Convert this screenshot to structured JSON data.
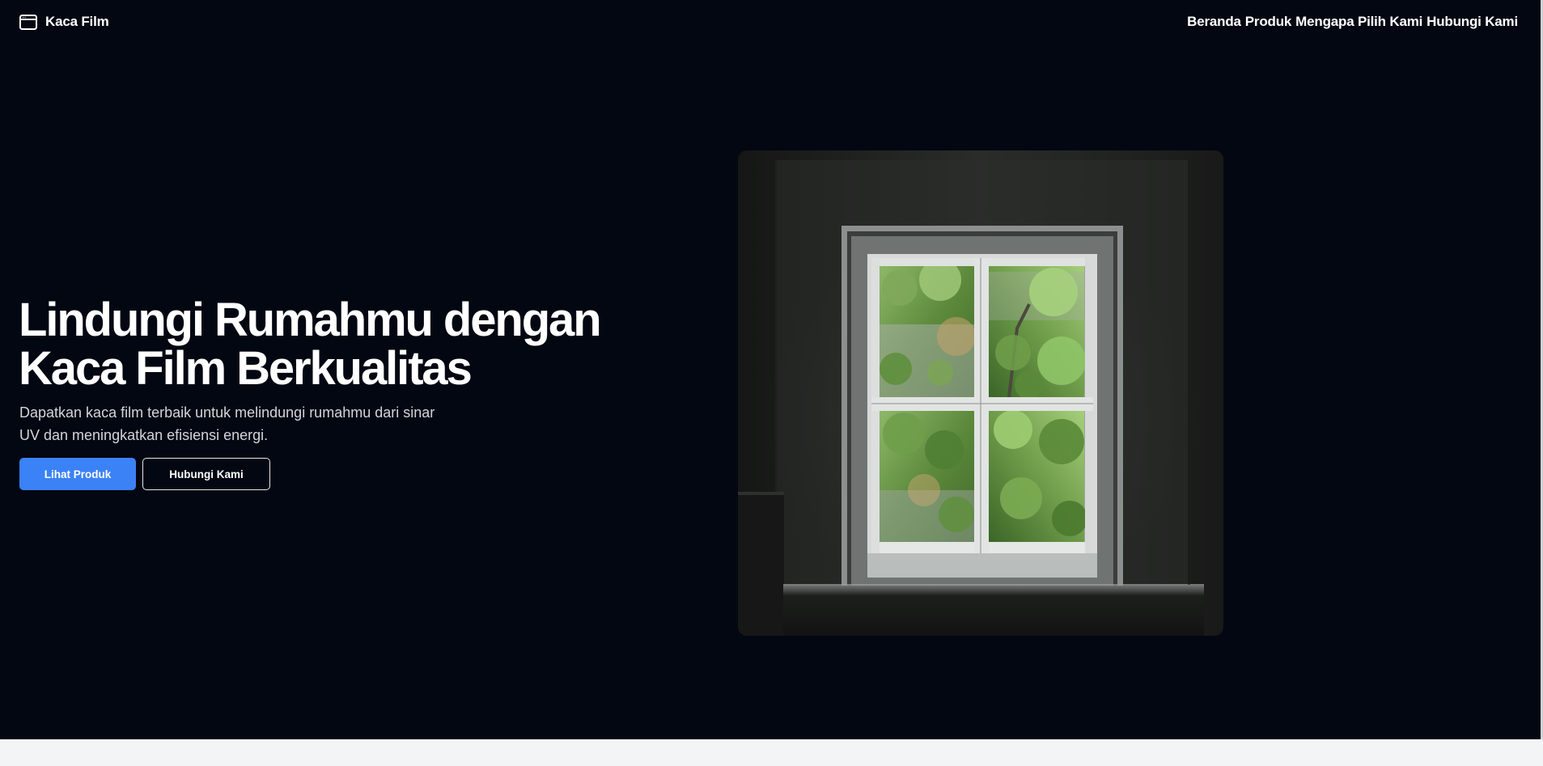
{
  "header": {
    "brand_name": "Kaca Film",
    "brand_icon": "browser-window-icon",
    "nav": [
      {
        "label": "Beranda"
      },
      {
        "label": "Produk"
      },
      {
        "label": "Mengapa Pilih Kami"
      },
      {
        "label": "Hubungi Kami"
      }
    ]
  },
  "hero": {
    "headline_line1": "Lindungi Rumahmu dengan",
    "headline_line2": "Kaca Film Berkualitas",
    "subtitle_line1": "Dapatkan kaca film terbaik untuk melindungi rumahmu dari sinar",
    "subtitle_line2": "UV dan meningkatkan efisiensi energi.",
    "primary_button": "Lihat Produk",
    "secondary_button": "Hubungi Kami",
    "image": "photo of a white-framed window in a dark room with green trees outside"
  },
  "colors": {
    "background": "#030712",
    "accent": "#3b82f6",
    "text": "#ffffff",
    "subtext": "#d1d5db",
    "below_fold": "#f3f4f6"
  }
}
